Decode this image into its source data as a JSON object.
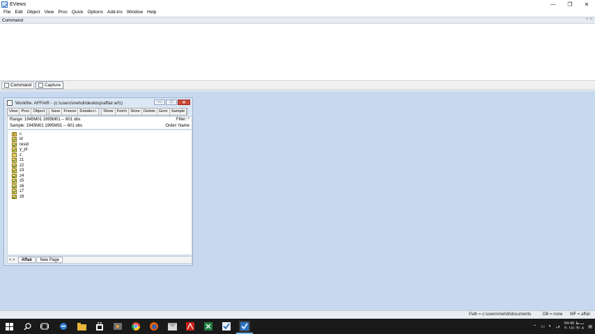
{
  "app": {
    "title": "EViews"
  },
  "window_controls": {
    "minimize": "—",
    "restore": "❐",
    "close": "✕"
  },
  "menu": [
    "File",
    "Edit",
    "Object",
    "View",
    "Proc",
    "Quick",
    "Options",
    "Add-ins",
    "Window",
    "Help"
  ],
  "command_pane": {
    "header": "Command",
    "pin_glyphs": "⌖ ✕",
    "tabs": [
      "Command",
      "Capture"
    ]
  },
  "workfile": {
    "title": "Workfile: AFFAIR - (c:\\users\\mehdi\\desktop\\affair.wf1)",
    "controls": {
      "minimize": "—",
      "maximize": "□",
      "close": "✕"
    },
    "toolbar_left": [
      "View",
      "Proc",
      "Object"
    ],
    "toolbar_mid": [
      "Save",
      "Freeze",
      "Details+/-"
    ],
    "toolbar_right": [
      "Show",
      "Fetch",
      "Store",
      "Delete",
      "Genr",
      "Sample"
    ],
    "range": "Range:  1945M01 1995M01  --  601 obs",
    "sample": "Sample: 1945M01 1995M01  --  601 obs",
    "filter": "Filter: *",
    "order": "Order: Name",
    "objects": [
      {
        "name": "c",
        "type": "coef",
        "glyph": "β"
      },
      {
        "name": "id",
        "type": "series",
        "glyph": ""
      },
      {
        "name": "resid",
        "type": "series",
        "glyph": ""
      },
      {
        "name": "y_pt",
        "type": "series",
        "glyph": ""
      },
      {
        "name": "z",
        "type": "other",
        "glyph": "▪"
      },
      {
        "name": "z1",
        "type": "series",
        "glyph": ""
      },
      {
        "name": "z2",
        "type": "series",
        "glyph": ""
      },
      {
        "name": "z3",
        "type": "series",
        "glyph": ""
      },
      {
        "name": "z4",
        "type": "series",
        "glyph": ""
      },
      {
        "name": "z5",
        "type": "series",
        "glyph": ""
      },
      {
        "name": "z6",
        "type": "series",
        "glyph": ""
      },
      {
        "name": "z7",
        "type": "series",
        "glyph": ""
      },
      {
        "name": "z8",
        "type": "series",
        "glyph": ""
      }
    ],
    "page_nav": "< >",
    "page_tabs": [
      "Affair",
      "New Page"
    ]
  },
  "status": {
    "path": "Path = c:\\users\\mehdi\\documents",
    "db": "DB = none",
    "wf": "WF = affair"
  },
  "taskbar": {
    "clock_time": "04:45 ب.ظ",
    "clock_date": "۲۰۱۶/۰۴/۰۸",
    "tray_lang": "ف"
  },
  "colors": {
    "desktop": "#c6d9ee",
    "taskbar": "#1a1a1a",
    "accent": "#76b9ed"
  }
}
